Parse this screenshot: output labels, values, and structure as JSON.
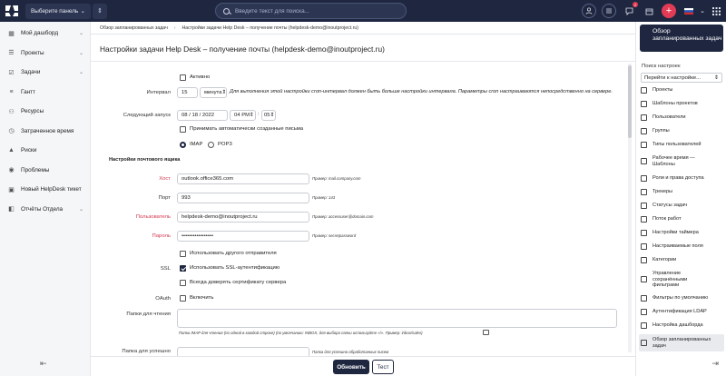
{
  "topbar": {
    "panel_label": "Выберите панель",
    "search_placeholder": "Введите текст для поиска...",
    "notif_count": "2"
  },
  "sidebar": {
    "items": [
      {
        "label": "Мой дашборд",
        "icon": "dashboard-icon"
      },
      {
        "label": "Проекты",
        "icon": "projects-icon"
      },
      {
        "label": "Задачи",
        "icon": "tasks-icon"
      },
      {
        "label": "Гантт",
        "icon": "gantt-icon"
      },
      {
        "label": "Ресурсы",
        "icon": "resources-icon"
      },
      {
        "label": "Затраченное время",
        "icon": "clock-icon"
      },
      {
        "label": "Риски",
        "icon": "risks-icon"
      },
      {
        "label": "Проблемы",
        "icon": "problems-icon"
      },
      {
        "label": "Новый HelpDesk тикет",
        "icon": "ticket-icon"
      },
      {
        "label": "Отчёты Отдела",
        "icon": "reports-icon"
      }
    ]
  },
  "breadcrumbs": {
    "item1": "Обзор запланированных задач",
    "item2": "Настройки задачи Help Desk – получение почты (helpdesk-demo@inoutproject.ru)"
  },
  "page": {
    "title": "Настройки задачи Help Desk – получение почты (helpdesk-demo@inoutproject.ru)"
  },
  "form": {
    "active_label": "Активно",
    "interval_label": "Интервал",
    "interval_value": "15",
    "interval_unit": "минута",
    "interval_note": "Для выполнения этой настройки cron-интервал должен быть больше настройки интервала. Параметры cron настраиваются непосредственно на сервере.",
    "next_run_label": "Следующий запуск",
    "next_run_date": "08 / 18 / 2022",
    "next_run_hour": "04 PM",
    "next_run_min": "05",
    "accept_auto_label": "Принимать автоматически созданные письма",
    "imap_label": "IMAP",
    "pop3_label": "POP3",
    "mailbox_section": "Настройки почтового ящика",
    "host_label": "Хост",
    "host_value": "outlook.office365.com",
    "host_hint": "Пример: mail.company.com",
    "port_label": "Порт",
    "port_value": "993",
    "port_hint": "Пример: 143",
    "user_label": "Пользователь",
    "user_value": "helpdesk-demo@inoutproject.ru",
    "user_hint": "Пример: accessuser@domain.com",
    "password_label": "Пароль",
    "password_value": "•••••••••••••••••",
    "password_hint": "Пример: secretpassword",
    "other_sender_label": "Использовать другого отправителя",
    "ssl_label": "SSL",
    "use_ssl_label": "Использовать SSL-аутентификацию",
    "trust_cert_label": "Всегда доверять сертификату сервера",
    "oauth_label": "OAuth",
    "enable_label": "Включить",
    "read_folders_label": "Папки для чтения",
    "read_folders_hint": "Папки IMAP для чтения (по одной в каждой строке) (по умолчанию: INBOX, для выбора папки используйте «/». Пример: inbox/sales)",
    "processed_label": "Папка для успешно",
    "processed_hint": "Папка для успешно обработанных писем"
  },
  "right_panel": {
    "header": "Обзор запланированных задач",
    "search_label": "Поиск настроек",
    "select_value": "Перейти к настройке...",
    "items": [
      "Проекты",
      "Шаблоны проектов",
      "Пользователи",
      "Группы",
      "Типы пользователей",
      "Рабочее время — Шаблоны",
      "Роли и права доступа",
      "Трекеры",
      "Статусы задач",
      "Поток работ",
      "Настройки таймера",
      "Настраиваемые поля",
      "Категории",
      "Управление сохранёнными фильтрами",
      "Фильтры по умолчанию",
      "Аутентификация LDAP",
      "Настройка дашборда",
      "Обзор запланированных задач"
    ]
  },
  "footer": {
    "update_label": "Обновить",
    "test_label": "Тест"
  }
}
